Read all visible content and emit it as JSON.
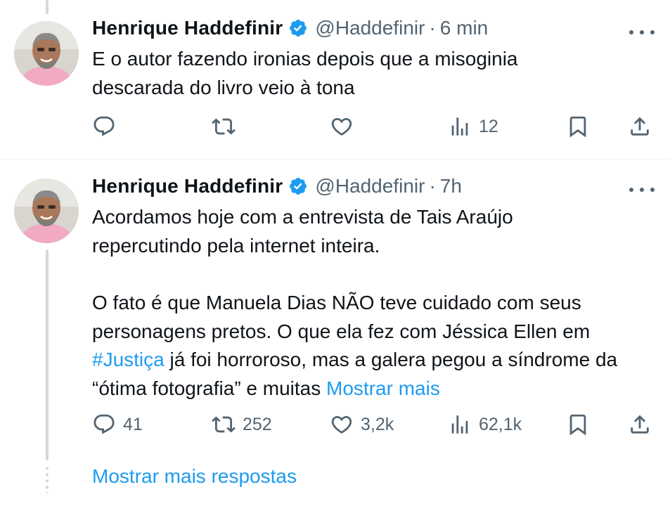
{
  "colors": {
    "accent": "#1d9bf0",
    "muted": "#536471",
    "text": "#0f1419",
    "verified": "#1d9bf0"
  },
  "tweets": [
    {
      "author": {
        "name": "Henrique Haddefinir",
        "handle": "@Haddefinir",
        "verified": true
      },
      "sep": "·",
      "time": "6 min",
      "text_lines": [
        "E o autor fazendo ironias depois que a misoginia descarada do livro veio à tona"
      ],
      "actions": {
        "reply": "",
        "retweet": "",
        "like": "",
        "views": "12"
      }
    },
    {
      "author": {
        "name": "Henrique Haddefinir",
        "handle": "@Haddefinir",
        "verified": true
      },
      "sep": "·",
      "time": "7h",
      "paragraph1": "Acordamos hoje com a entrevista de Tais Araújo repercutindo pela internet inteira.",
      "paragraph2_before": "O fato é que Manuela Dias NÃO teve cuidado com seus personagens pretos. O que ela fez com Jéssica Ellen em ",
      "hashtag": "#Justiça",
      "paragraph2_after": " já foi horroroso, mas a galera pegou a síndrome da “ótima fotografia” e muitas ",
      "show_more": "Mostrar mais",
      "actions": {
        "reply": "41",
        "retweet": "252",
        "like": "3,2k",
        "views": "62,1k"
      }
    }
  ],
  "more_replies": "Mostrar mais respostas",
  "icons": [
    "reply-icon",
    "retweet-icon",
    "like-icon",
    "views-icon",
    "bookmark-icon",
    "share-icon",
    "verified-badge-icon",
    "more-options-icon"
  ]
}
